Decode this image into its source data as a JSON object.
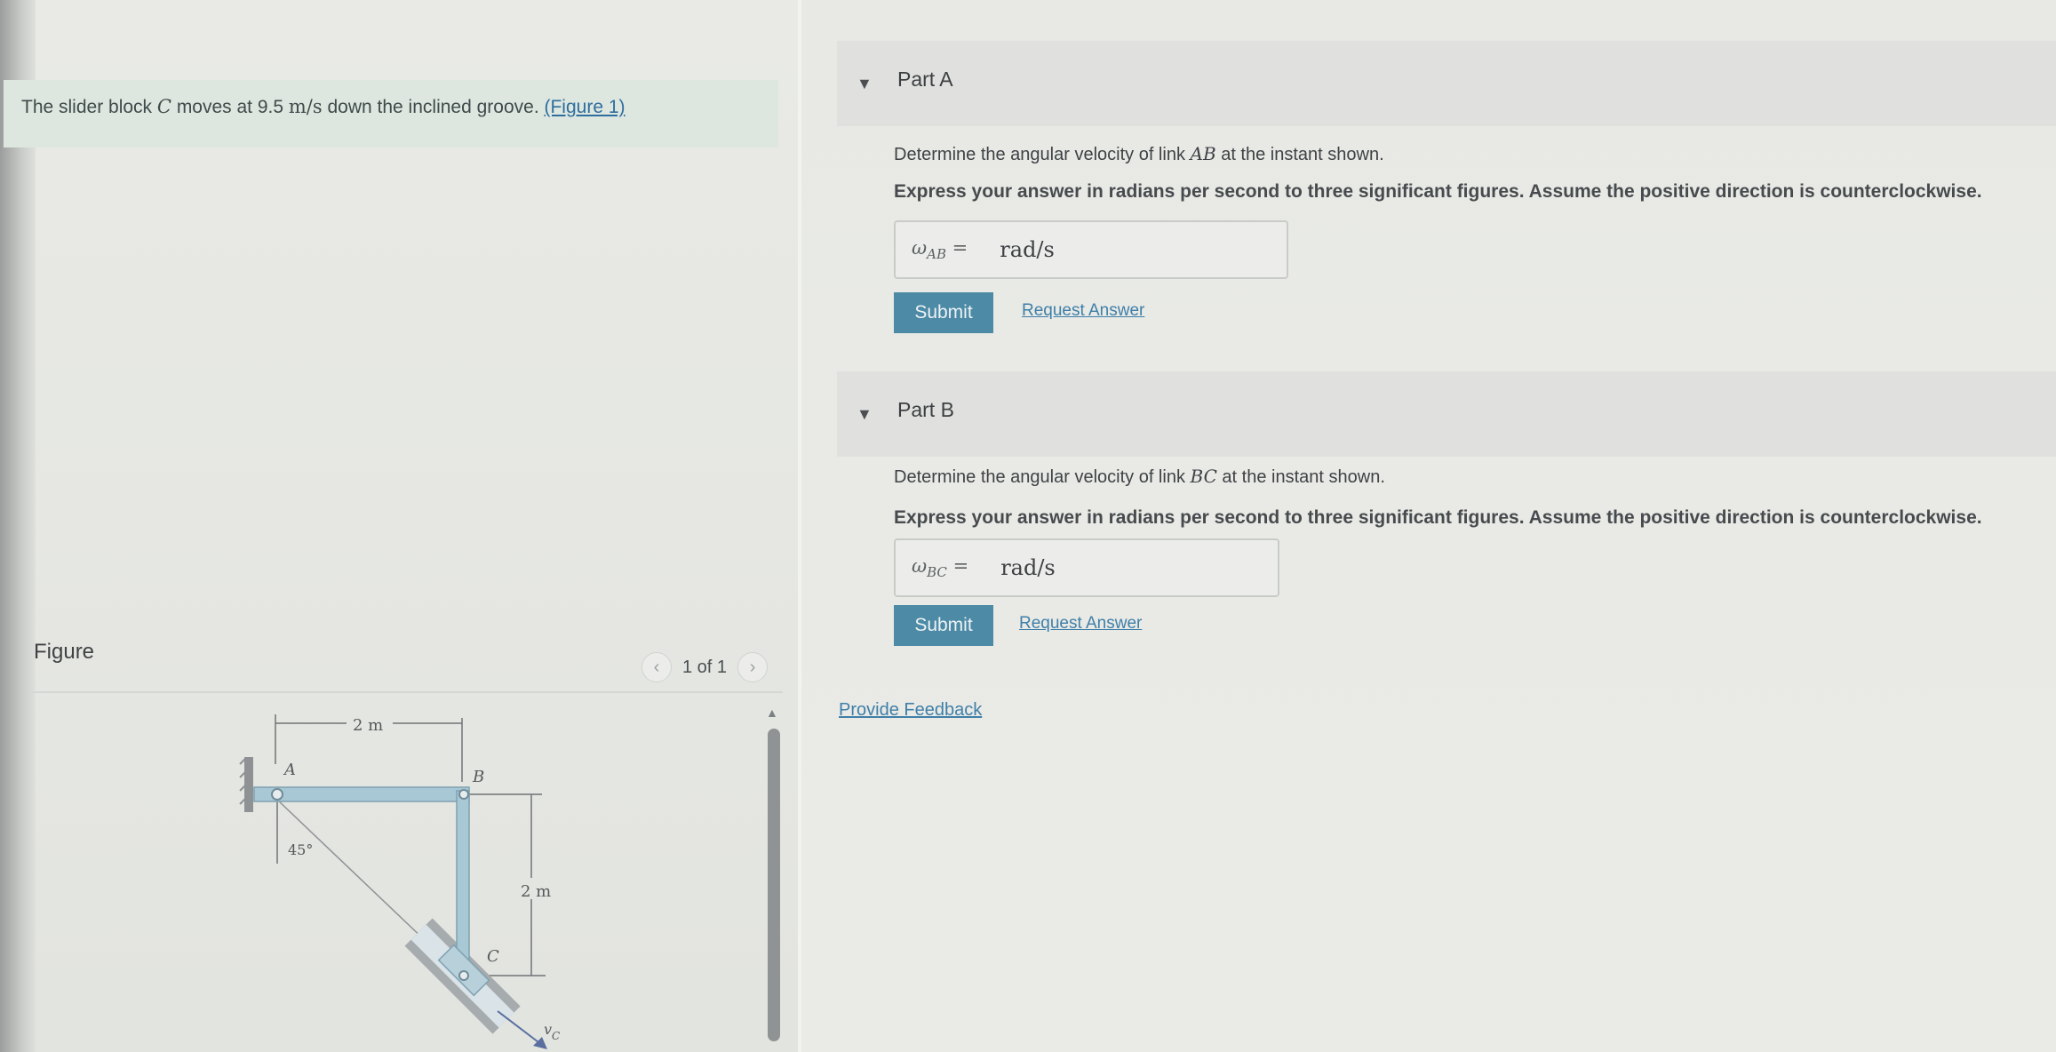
{
  "intro": {
    "text_before": "The slider block ",
    "var": "C",
    "text_middle": " moves at 9.5 ",
    "unit": "m/s",
    "text_after": " down the inclined groove. ",
    "figure_link": "(Figure 1)"
  },
  "figure": {
    "title": "Figure",
    "pager": "1 of 1",
    "labels": {
      "top_dim": "2 m",
      "right_dim": "2 m",
      "point_a": "A",
      "point_b": "B",
      "point_c": "C",
      "angle": "45°",
      "velocity": "v",
      "velocity_sub": "C"
    }
  },
  "part_a": {
    "title": "Part A",
    "question_before": "Determine the angular velocity of link ",
    "question_var": "AB",
    "question_after": " at the instant shown.",
    "instruction": "Express your answer in radians per second to three significant figures. Assume the positive direction is counterclockwise.",
    "var_symbol": "ω",
    "var_sub": "AB",
    "equals": "=",
    "unit": "rad/s",
    "submit": "Submit",
    "request": "Request Answer"
  },
  "part_b": {
    "title": "Part B",
    "question_before": "Determine the angular velocity of link ",
    "question_var": "BC",
    "question_after": " at the instant shown.",
    "instruction": "Express your answer in radians per second to three significant figures. Assume the positive direction is counterclockwise.",
    "var_symbol": "ω",
    "var_sub": "BC",
    "equals": "=",
    "unit": "rad/s",
    "submit": "Submit",
    "request": "Request Answer"
  },
  "feedback": "Provide Feedback",
  "colors": {
    "accent": "#4c8aa6",
    "link": "#3f7fa8",
    "intro_bg": "#dde7e0",
    "link_bar": "#a9c8d6"
  }
}
